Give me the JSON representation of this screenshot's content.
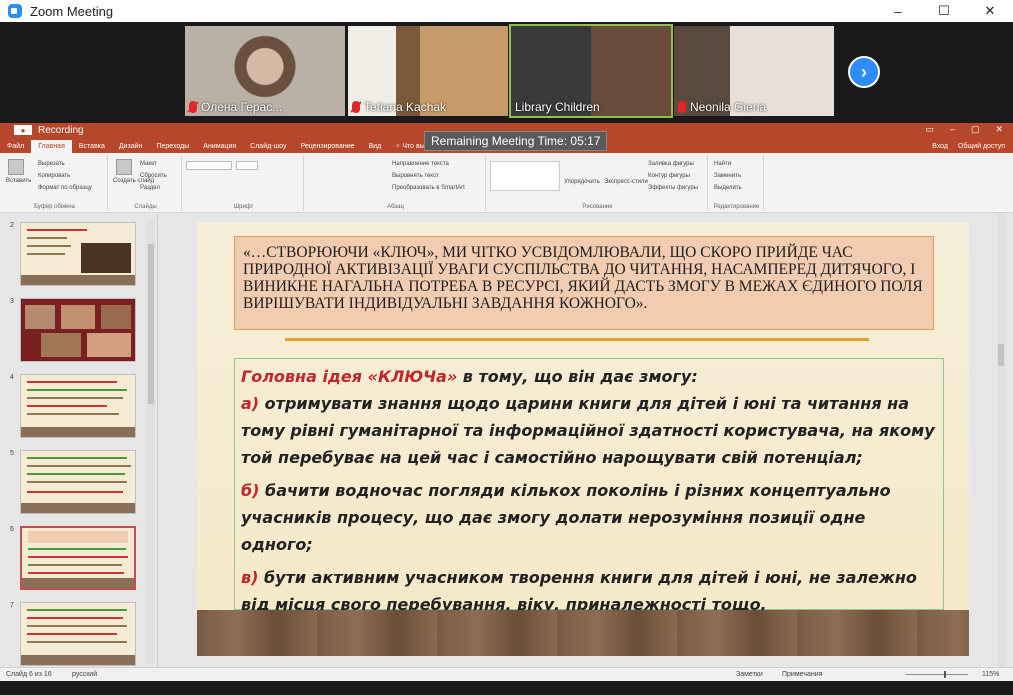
{
  "zoom": {
    "title": "Zoom Meeting",
    "window_controls": [
      "–",
      "☐",
      "✕"
    ]
  },
  "gallery": {
    "participants": [
      {
        "name": "Олена Герас...",
        "muted": true
      },
      {
        "name": "Tetiana Kachak",
        "muted": true
      },
      {
        "name": "Library Children",
        "muted": false,
        "active": true
      },
      {
        "name": "Neonila Giena",
        "muted": true
      }
    ],
    "next_arrow": "›"
  },
  "ppt": {
    "recording_label": "Recording",
    "remaining_time": "Remaining Meeting Time: 05:17",
    "title_right": [
      "▭",
      "–",
      "▢",
      "✕"
    ],
    "tabs": [
      "Файл",
      "Главная",
      "Вставка",
      "Дизайн",
      "Переходы",
      "Анимация",
      "Слайд-шоу",
      "Рецензирование",
      "Вид",
      "♀ Что вы хотите сделать?"
    ],
    "tabs_right": [
      "Вход",
      "Общий доступ"
    ],
    "ribbon": {
      "paste": "Вставить",
      "clipboard_items": [
        "Вырезать",
        "Копировать",
        "Формат по образцу"
      ],
      "create_slide": "Создать слайд",
      "slide_items": [
        "Макет",
        "Сбросить",
        "Раздел"
      ],
      "paragraph_items": [
        "Направление текста",
        "Выровнять текст",
        "Преобразовать в SmartArt"
      ],
      "arrange": "Упорядочить",
      "express_styles": "Экспресс-стили",
      "drawing_items": [
        "Заливка фигуры",
        "Контур фигуры",
        "Эффекты фигуры"
      ],
      "editing_items": [
        "Найти",
        "Заменить",
        "Выделить"
      ],
      "group_labels": [
        "Буфер обмена",
        "Слайды",
        "Шрифт",
        "Абзац",
        "Рисование",
        "Редактирование"
      ]
    },
    "thumbnails": [
      {
        "number": "2"
      },
      {
        "number": "3"
      },
      {
        "number": "4"
      },
      {
        "number": "5"
      },
      {
        "number": "6",
        "selected": true
      },
      {
        "number": "7"
      }
    ],
    "slide": {
      "quote": "«…СТВОРЮЮЧИ «КЛЮЧ», МИ ЧІТКО УСВІДОМЛЮВАЛИ, ЩО СКОРО ПРИЙДЕ ЧАС ПРИРОДНОЇ АКТИВІЗАЦІЇ УВАГИ СУСПІЛЬСТВА ДО ЧИТАННЯ, НАСАМПЕРЕД ДИТЯЧОГО, І ВИНИКНЕ НАГАЛЬНА ПОТРЕБА В РЕСУРСІ, ЯКИЙ ДАСТЬ ЗМОГУ В МЕЖАХ ЄДИНОГО ПОЛЯ ВИРІШУВАТИ ІНДИВІДУАЛЬНІ ЗАВДАННЯ КОЖНОГО».",
      "heading_red": "Головна ідея «КЛЮЧа»",
      "heading_rest": " в тому, що він дає змогу:",
      "items": [
        {
          "marker": "а)",
          "text": " отримувати знання щодо царини книги для дітей і юні та читання на тому рівні гуманітарної та інформаційної здатності користувача, на якому той перебуває на цей час і самостійно нарощувати свій потенціал;"
        },
        {
          "marker": "б)",
          "text": " бачити водночас погляди кількох поколінь і різних концептуально учасників процесу, що дає змогу долати нерозуміння позиції одне одного;"
        },
        {
          "marker": "в)",
          "text": " бути активним учасником творення книги для дітей і юні, не залежно від місця свого перебування, віку, приналежності тощо."
        }
      ]
    },
    "status": {
      "slide_counter": "Слайд 6 из 16",
      "language": "русский",
      "notes": "Заметки",
      "comments": "Примечания",
      "zoom_level": "115%"
    }
  }
}
